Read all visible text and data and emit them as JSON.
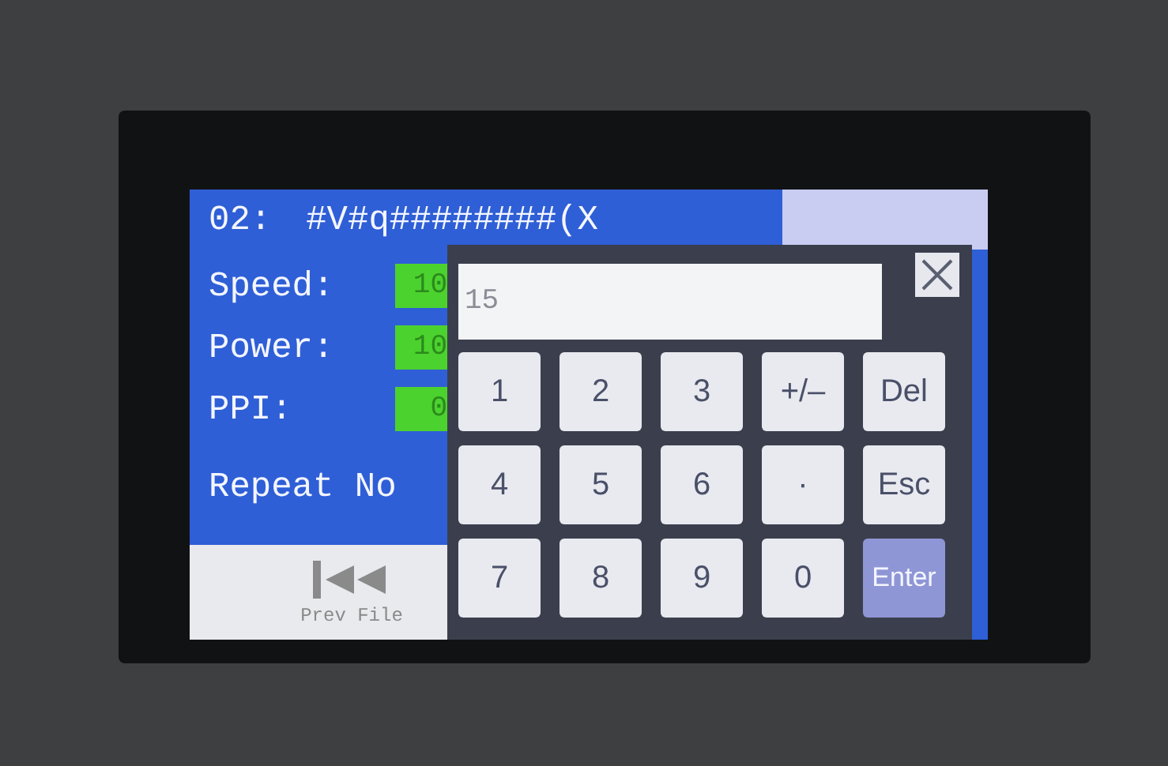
{
  "title": {
    "number": "02:",
    "name": "#V#q########(X"
  },
  "fields": [
    {
      "label": "Speed:",
      "value": "10"
    },
    {
      "label": "Power:",
      "value": "10"
    },
    {
      "label": "PPI:",
      "value": "0"
    }
  ],
  "repeat_label": "Repeat No",
  "prev_button": {
    "label": "Prev File"
  },
  "keypad": {
    "value": "15",
    "keys": [
      {
        "label": "1",
        "kind": "key"
      },
      {
        "label": "2",
        "kind": "key"
      },
      {
        "label": "3",
        "kind": "key"
      },
      {
        "label": "+/–",
        "kind": "key"
      },
      {
        "label": "Del",
        "kind": "key"
      },
      {
        "label": "4",
        "kind": "key"
      },
      {
        "label": "5",
        "kind": "key"
      },
      {
        "label": "6",
        "kind": "key"
      },
      {
        "label": "·",
        "kind": "key"
      },
      {
        "label": "Esc",
        "kind": "key"
      },
      {
        "label": "7",
        "kind": "key"
      },
      {
        "label": "8",
        "kind": "key"
      },
      {
        "label": "9",
        "kind": "key"
      },
      {
        "label": "0",
        "kind": "key"
      },
      {
        "label": "Enter",
        "kind": "enter"
      }
    ]
  }
}
